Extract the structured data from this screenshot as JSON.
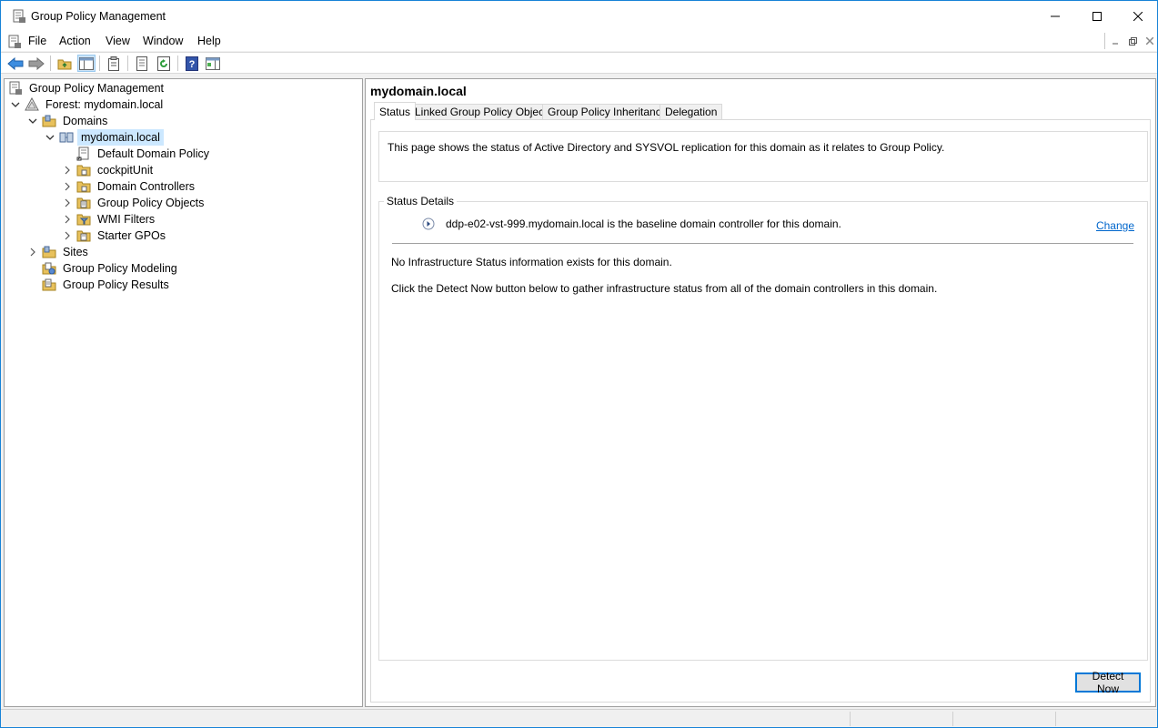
{
  "window": {
    "title": "Group Policy Management",
    "icon": "gpmc-icon"
  },
  "menubar": {
    "items": [
      "File",
      "Action",
      "View",
      "Window",
      "Help"
    ]
  },
  "toolbar": {
    "buttons": [
      "back-arrow-icon",
      "forward-arrow-icon",
      "up-folder-icon",
      "show-hide-console-tree-icon",
      "properties-icon",
      "export-list-icon",
      "refresh-icon",
      "help-icon",
      "show-hide-action-pane-icon"
    ]
  },
  "tree": {
    "root": "Group Policy Management",
    "forest": "Forest: mydomain.local",
    "domains": "Domains",
    "domain": "mydomain.local",
    "default_policy": "Default Domain Policy",
    "ou_cockpit": "cockpitUnit",
    "domain_controllers": "Domain Controllers",
    "gpo": "Group Policy Objects",
    "wmi": "WMI Filters",
    "starter": "Starter GPOs",
    "sites": "Sites",
    "modeling": "Group Policy Modeling",
    "results": "Group Policy Results"
  },
  "content": {
    "title": "mydomain.local",
    "tabs": [
      "Status",
      "Linked Group Policy Objects",
      "Group Policy Inheritance",
      "Delegation"
    ],
    "description": "This page shows the status of Active Directory and SYSVOL replication for this domain as it relates to Group Policy.",
    "details_legend": "Status Details",
    "baseline_text": "ddp-e02-vst-999.mydomain.local is the baseline domain controller for this domain.",
    "change_link": "Change",
    "no_info": "No Infrastructure Status information exists for this domain.",
    "instruction": "Click the Detect Now button below to gather infrastructure status from all of the domain controllers in this domain.",
    "detect_button": "Detect Now"
  }
}
